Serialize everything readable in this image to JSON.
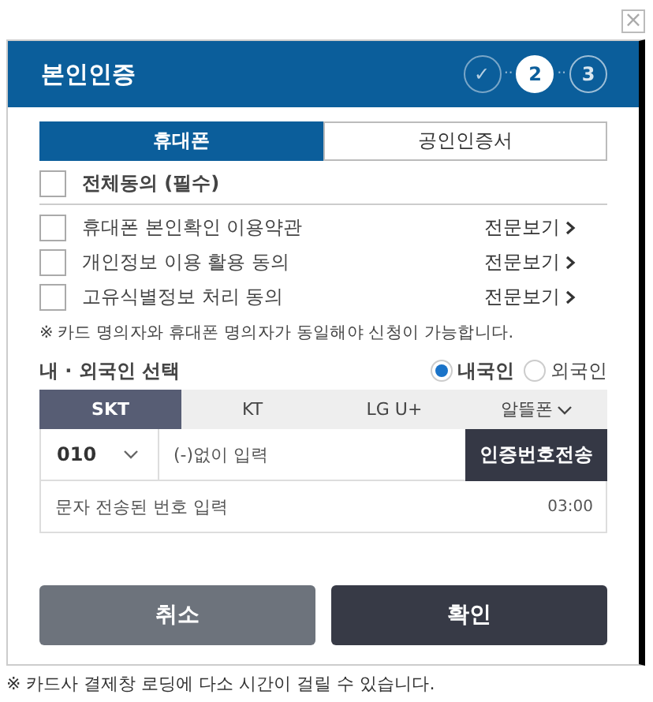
{
  "close_button": {
    "label": "×"
  },
  "header": {
    "title": "본인인증",
    "steps": [
      {
        "label": "✓",
        "completed": true,
        "selected": false
      },
      {
        "label": "2",
        "completed": false,
        "selected": true
      },
      {
        "label": "3",
        "completed": false,
        "selected": false
      }
    ],
    "separator": "··"
  },
  "tabs": [
    {
      "label": "휴대폰",
      "selected": true
    },
    {
      "label": "공인인증서",
      "selected": false
    }
  ],
  "agree_all": {
    "label": "전체동의 (필수)",
    "checked": false
  },
  "agreements": [
    {
      "label": "휴대폰 본인확인 이용약관",
      "checked": false,
      "link": "전문보기"
    },
    {
      "label": "개인정보 이용 활용 동의",
      "checked": false,
      "link": "전문보기"
    },
    {
      "label": "고유식별정보 처리 동의",
      "checked": false,
      "link": "전문보기"
    }
  ],
  "notice": "※ 카드 명의자와 휴대폰 명의자가 동일해야 신청이 가능합니다.",
  "nationality": {
    "label": "내 · 외국인 선택",
    "options": [
      {
        "label": "내국인",
        "selected": true
      },
      {
        "label": "외국인",
        "selected": false
      }
    ]
  },
  "carriers": [
    {
      "label": "SKT",
      "selected": true,
      "kind": "plain"
    },
    {
      "label": "KT",
      "selected": false,
      "kind": "plain"
    },
    {
      "label": "LG U+",
      "selected": false,
      "kind": "plain"
    },
    {
      "label": "알뜰폰",
      "selected": false,
      "kind": "dropdown"
    }
  ],
  "phone": {
    "prefix": "010",
    "placeholder": "(-)없이 입력",
    "send_button": "인증번호전송"
  },
  "code": {
    "placeholder": "문자 전송된 번호 입력",
    "timer": "03:00"
  },
  "buttons": [
    {
      "label": "취소",
      "kind": "cancel"
    },
    {
      "label": "확인",
      "kind": "confirm"
    }
  ],
  "footnote": "※ 카드사 결제창 로딩에 다소 시간이 걸릴 수 있습니다."
}
